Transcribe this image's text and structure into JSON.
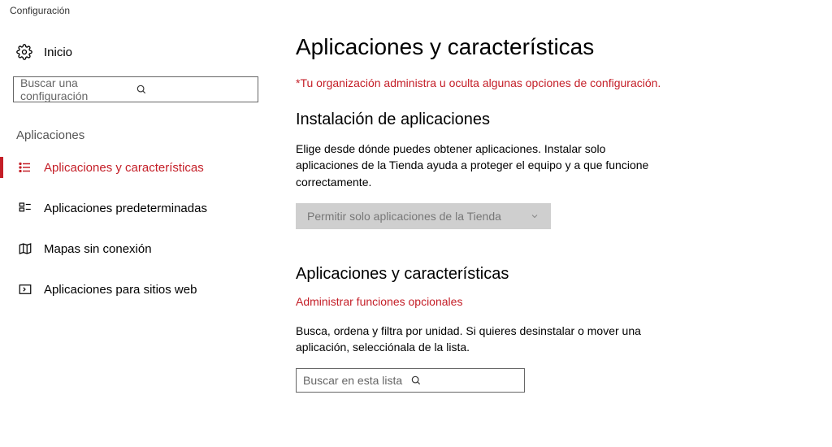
{
  "window": {
    "title": "Configuración"
  },
  "sidebar": {
    "home_label": "Inicio",
    "search_placeholder": "Buscar una configuración",
    "group_header": "Aplicaciones",
    "items": [
      {
        "label": "Aplicaciones y características"
      },
      {
        "label": "Aplicaciones predeterminadas"
      },
      {
        "label": "Mapas sin conexión"
      },
      {
        "label": "Aplicaciones para sitios web"
      }
    ]
  },
  "content": {
    "page_title": "Aplicaciones y características",
    "org_banner": "*Tu organización administra u oculta algunas opciones de configuración.",
    "install": {
      "title": "Instalación de aplicaciones",
      "body": "Elige desde dónde puedes obtener aplicaciones. Instalar solo aplicaciones de la Tienda ayuda a proteger el equipo y a que funcione correctamente.",
      "dropdown_selected": "Permitir solo aplicaciones de la Tienda"
    },
    "apps": {
      "title": "Aplicaciones y características",
      "link": "Administrar funciones opcionales",
      "body": "Busca, ordena y filtra por unidad. Si quieres desinstalar o mover una aplicación, selecciónala de la lista.",
      "search_placeholder": "Buscar en esta lista"
    }
  },
  "colors": {
    "accent": "#C41E27"
  }
}
